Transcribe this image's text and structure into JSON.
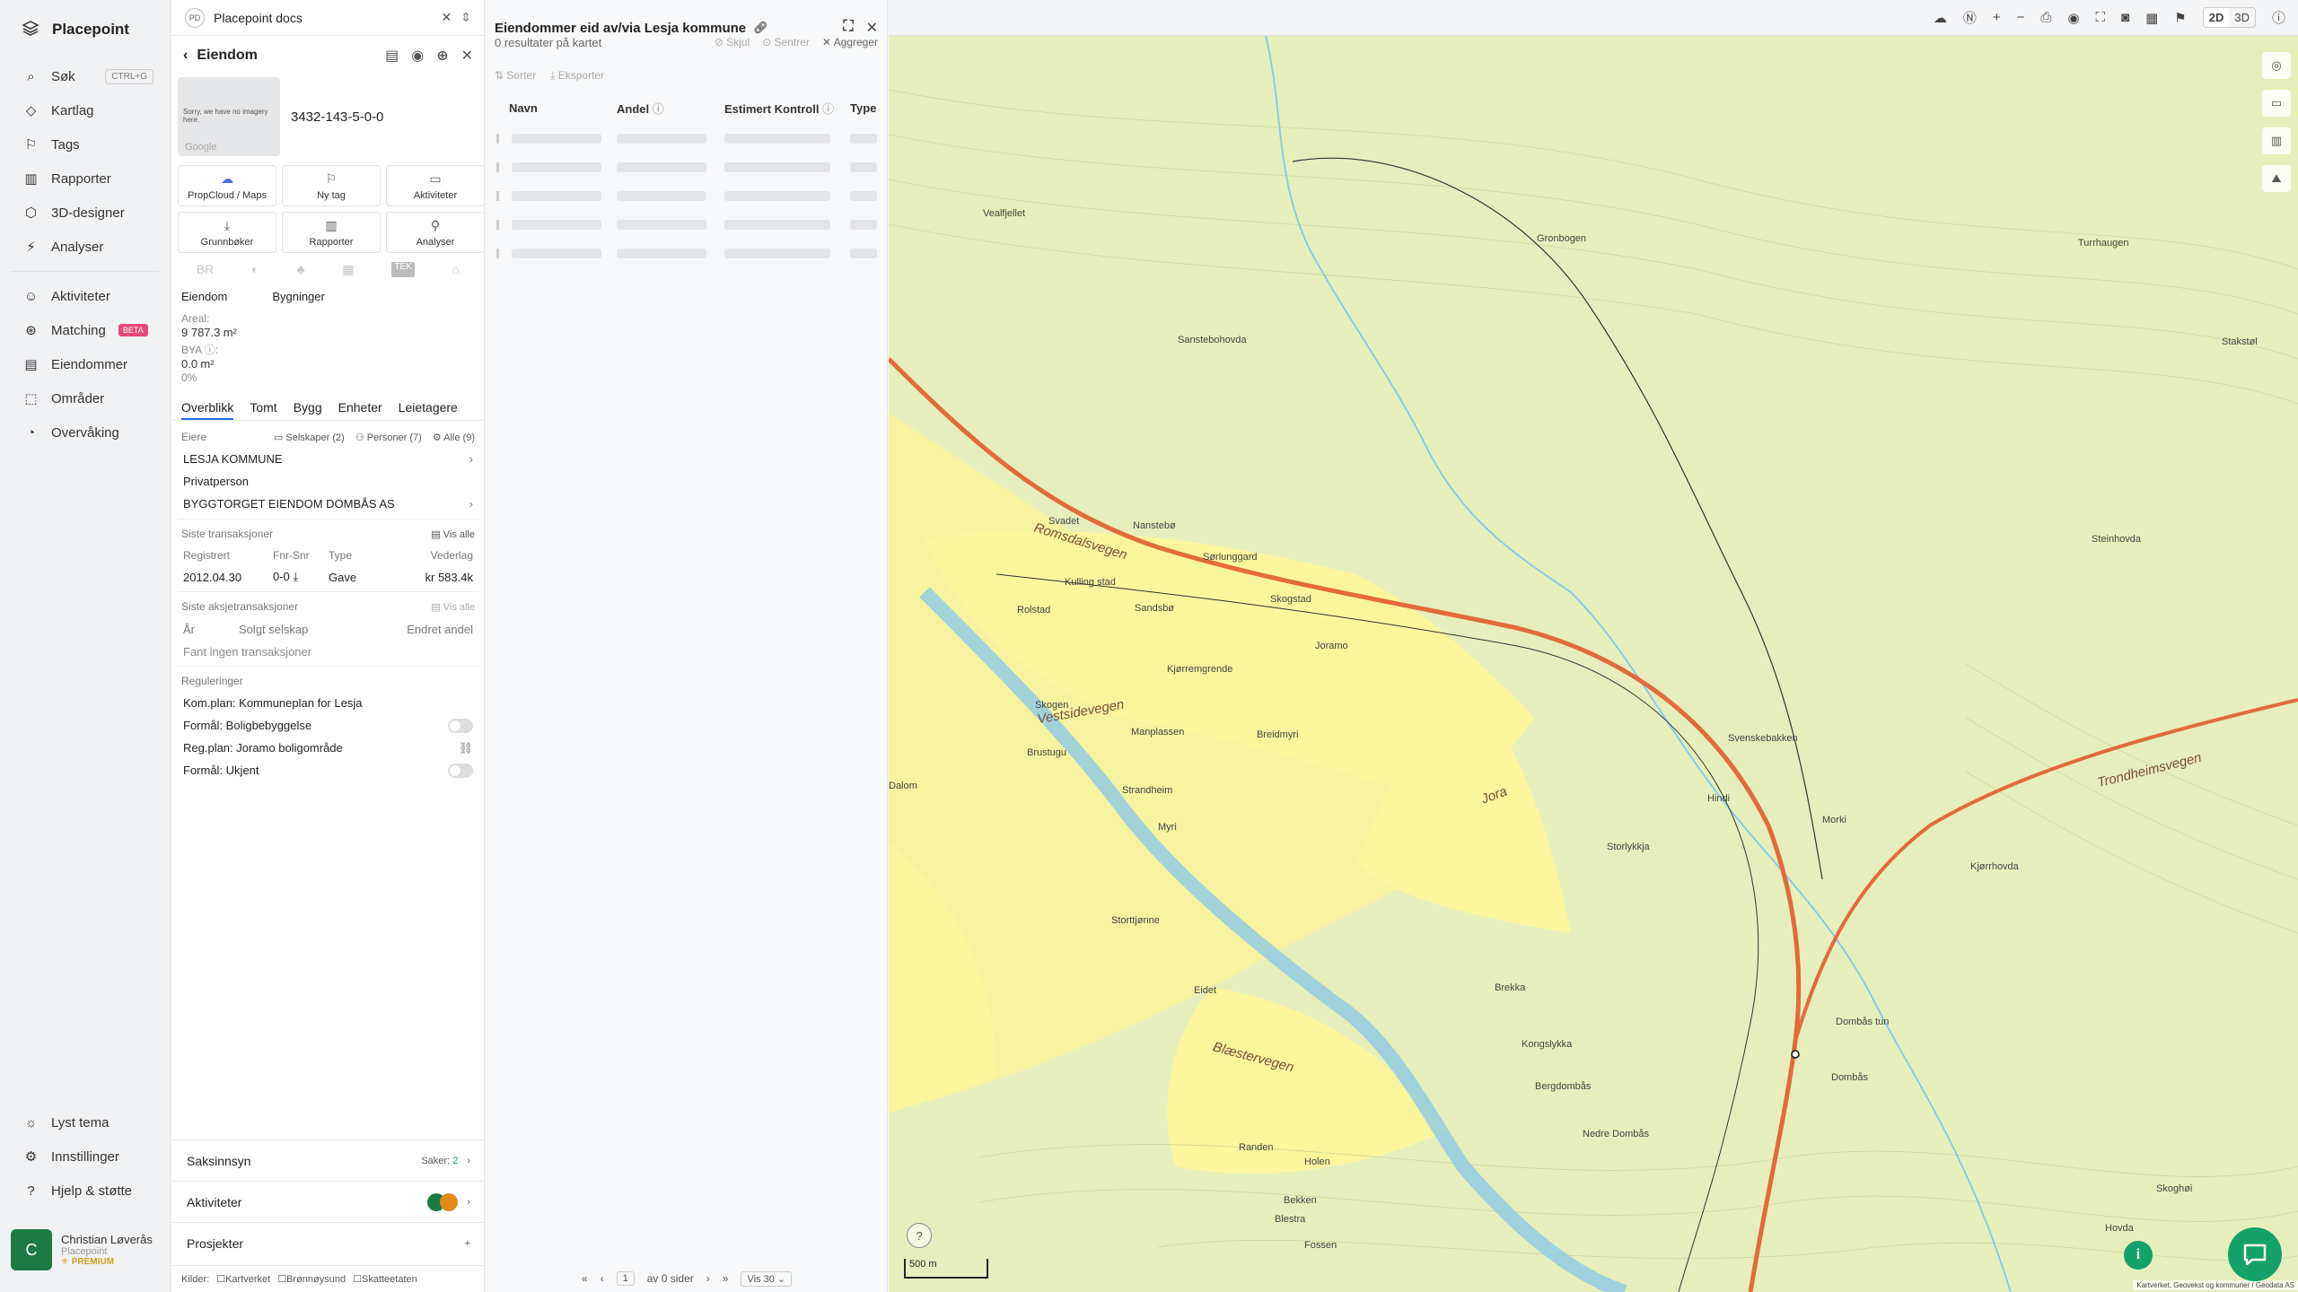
{
  "nav": {
    "brand": "Placepoint",
    "items": [
      {
        "label": "Søk",
        "icon": "search-icon",
        "kbd": "CTRL+G"
      },
      {
        "label": "Kartlag",
        "icon": "layers-icon"
      },
      {
        "label": "Tags",
        "icon": "bookmark-icon"
      },
      {
        "label": "Rapporter",
        "icon": "chart-icon"
      },
      {
        "label": "3D-designer",
        "icon": "cube-icon"
      },
      {
        "label": "Analyser",
        "icon": "bolt-icon"
      }
    ],
    "items2": [
      {
        "label": "Aktiviteter",
        "icon": "chat-icon"
      },
      {
        "label": "Matching",
        "icon": "matching-icon",
        "badge": "BETA"
      },
      {
        "label": "Eiendommer",
        "icon": "building-icon"
      },
      {
        "label": "Områder",
        "icon": "area-icon"
      },
      {
        "label": "Overvåking",
        "icon": "monitor-icon"
      }
    ],
    "bottom": [
      {
        "label": "Lyst tema",
        "icon": "sun-icon"
      },
      {
        "label": "Innstillinger",
        "icon": "gear-icon"
      },
      {
        "label": "Hjelp & støtte",
        "icon": "help-icon"
      }
    ],
    "user": {
      "initial": "C",
      "name": "Christian Løverås",
      "org": "Placepoint",
      "plan": "PREMIUM"
    }
  },
  "property": {
    "docs_badge": "PD",
    "docs_title": "Placepoint docs",
    "title": "Eiendom",
    "no_imagery": "Sorry, we have no imagery here.",
    "google": "Google",
    "property_id": "3432-143-5-0-0",
    "tiles": [
      "PropCloud / Maps",
      "Ny tag",
      "Aktiviteter",
      "Grunnbøker",
      "Rapporter",
      "Analyser"
    ],
    "icon_row": [
      "BR",
      "TEK"
    ],
    "subtabs": [
      "Eiendom",
      "Bygninger"
    ],
    "areal_label": "Areal:",
    "areal_value": "9 787.3",
    "areal_unit": "m²",
    "bya_label": "BYA",
    "bya_value": "0.0",
    "bya_unit": "m²",
    "bya_pct": "0%",
    "tabs": [
      "Overblikk",
      "Tomt",
      "Bygg",
      "Enheter",
      "Leietagere"
    ],
    "owners_label": "Eiere",
    "owner_filters": [
      "Selskaper (2)",
      "Personer (7)",
      "Alle (9)"
    ],
    "owners": [
      "LESJA KOMMUNE",
      "Privatperson",
      "BYGGTORGET EIENDOM DOMBÅS AS"
    ],
    "tx_title": "Siste transaksjoner",
    "view_all": "Vis alle",
    "tx_headers": [
      "Registrert",
      "Fnr-Snr",
      "Type",
      "Vederlag"
    ],
    "tx_rows": [
      [
        "2012.04.30",
        "0-0",
        "Gave",
        "kr 583.4k"
      ]
    ],
    "akt_title": "Siste aksjetransaksjoner",
    "akt_view_all": "Vis alle",
    "akt_headers": [
      "År",
      "Solgt selskap",
      "Endret andel"
    ],
    "akt_empty": "Fant ingen transaksjoner",
    "reg_title": "Reguleringer",
    "reg_items": [
      "Kom.plan: Kommuneplan for Lesja",
      "Formål: Boligbebyggelse",
      "Reg.plan: Joramo boligområde",
      "Formål: Ukjent"
    ],
    "saksinnsyn": "Saksinnsyn",
    "saker_label": "Saker:",
    "saker_count": "2",
    "aktiviteter": "Aktiviteter",
    "prosjekter": "Prosjekter",
    "kilder_label": "Kilder:",
    "kilder": [
      "Kartverket",
      "Brønnøysund",
      "Skatteetaten"
    ]
  },
  "results": {
    "title": "Eiendommer eid av/via Lesja kommune",
    "count_text": "0 resultater på kartet",
    "actions": [
      "Skjul",
      "Sentrer",
      "Aggreger"
    ],
    "tools": [
      "Sorter",
      "Eksporter"
    ],
    "columns": [
      "Navn",
      "Andel",
      "Estimert Kontroll",
      "Type"
    ],
    "pager_page": "1",
    "pager_of": "av 0 sider",
    "pager_show": "Vis 30"
  },
  "map": {
    "top_2d": "2D",
    "top_3d": "3D",
    "scale": "500 m",
    "attribution": "Kartverket, Geovekst og kommuner / Geodata AS",
    "labels": [
      "Vealfjellet",
      "Gronbogen",
      "Turrhaugen",
      "Sanstebohovda",
      "Steinhovda",
      "Stakstøl",
      "Svadet",
      "Nanstebø",
      "Sørlunggard",
      "Skogstad",
      "Kulling stad",
      "Rolstad",
      "Sandsbø",
      "Joramo",
      "Kjørremgrende",
      "Skogen",
      "Manplassen",
      "Breidmyri",
      "Brustugu",
      "Strandheim",
      "Myri",
      "Dalom",
      "Svenskebakken",
      "Morki",
      "Hindi",
      "Kjørrhovda",
      "Eidet",
      "Brekka",
      "Kongslykka",
      "Dombås tun",
      "Bergdombås",
      "Dombås",
      "Nedre Dombås",
      "Randen",
      "Holen",
      "Bekken",
      "Blestra",
      "Fossen",
      "Skoghøi",
      "Hovda",
      "Storttjønne",
      "Storlykkja"
    ],
    "roads": [
      "Romsdalsvegen",
      "Vestsidevegen",
      "Blæstervegen",
      "Trondheimsvegen",
      "Jora"
    ]
  }
}
